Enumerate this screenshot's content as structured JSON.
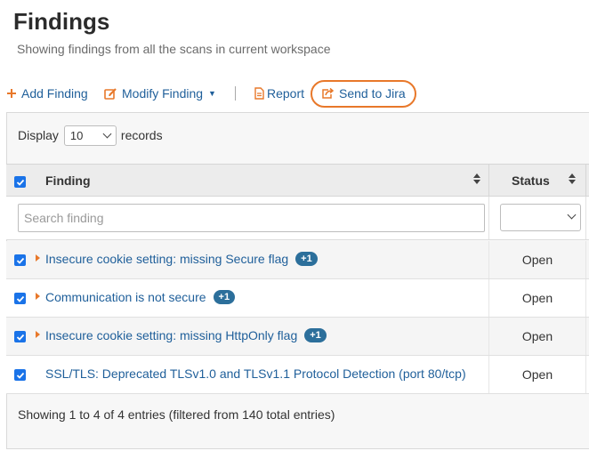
{
  "page": {
    "title": "Findings",
    "subtitle": "Showing findings from all the scans in current workspace"
  },
  "toolbar": {
    "add_label": "Add Finding",
    "modify_label": "Modify Finding",
    "report_label": "Report",
    "jira_label": "Send to Jira",
    "accent_color": "#e8782a",
    "link_color": "#1f5f9a"
  },
  "table": {
    "length_label_before": "Display",
    "length_value": "10",
    "length_label_after": "records",
    "columns": [
      "Finding",
      "Status"
    ],
    "search_placeholder": "Search finding",
    "status_filter_value": "",
    "rows": [
      {
        "finding": "Insecure cookie setting: missing Secure flag",
        "badge": "+1",
        "status": "Open",
        "checked": true
      },
      {
        "finding": "Communication is not secure",
        "badge": "+1",
        "status": "Open",
        "checked": true
      },
      {
        "finding": "Insecure cookie setting: missing HttpOnly flag",
        "badge": "+1",
        "status": "Open",
        "checked": true
      },
      {
        "finding": "SSL/TLS: Deprecated TLSv1.0 and TLSv1.1 Protocol Detection (port 80/tcp)",
        "badge": "",
        "status": "Open",
        "checked": true
      }
    ],
    "info": "Showing 1 to 4 of 4 entries (filtered from 140 total entries)"
  },
  "icons": {
    "add": "plus-icon",
    "modify": "edit-icon",
    "report": "document-icon",
    "jira": "share-icon",
    "sort": "sort-icon",
    "expand": "caret-right-icon",
    "checkbox": "checkbox-checked-icon"
  }
}
